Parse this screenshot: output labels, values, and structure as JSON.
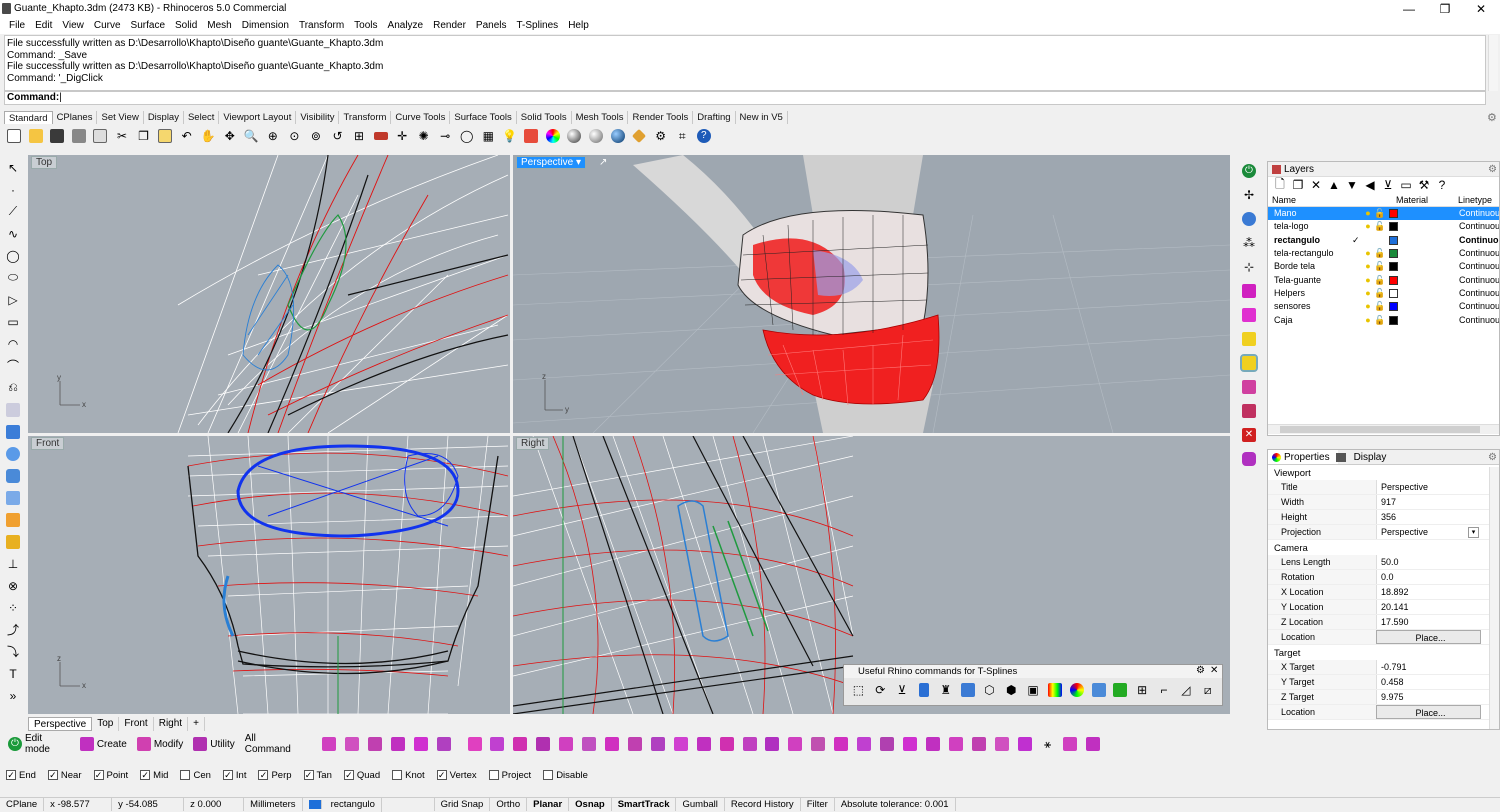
{
  "window": {
    "title": "Guante_Khapto.3dm (2473 KB) - Rhinoceros 5.0 Commercial",
    "minimize": "—",
    "maximize": "❐",
    "close": "✕"
  },
  "menu": [
    "File",
    "Edit",
    "View",
    "Curve",
    "Surface",
    "Solid",
    "Mesh",
    "Dimension",
    "Transform",
    "Tools",
    "Analyze",
    "Render",
    "Panels",
    "T-Splines",
    "Help"
  ],
  "history": [
    "File successfully written as D:\\Desarrollo\\Khapto\\Diseño guante\\Guante_Khapto.3dm",
    "Command: _Save",
    "File successfully written as D:\\Desarrollo\\Khapto\\Diseño guante\\Guante_Khapto.3dm",
    "Command: '_DigClick"
  ],
  "command_label": "Command:",
  "toolbar_tabs": [
    "Standard",
    "CPlanes",
    "Set View",
    "Display",
    "Select",
    "Viewport Layout",
    "Visibility",
    "Transform",
    "Curve Tools",
    "Surface Tools",
    "Solid Tools",
    "Mesh Tools",
    "Render Tools",
    "Drafting",
    "New in V5"
  ],
  "standard_icons": [
    "new-icon",
    "open-icon",
    "save-icon",
    "print-icon",
    "import-icon",
    "cut-icon",
    "copy-icon",
    "paste-icon",
    "undo-icon",
    "pan-icon",
    "rotate-icon",
    "zoom-dynamic-icon",
    "zoom-window-icon",
    "zoom-extents-icon",
    "zoom-selected-icon",
    "undo-view-icon",
    "four-viewports-icon",
    "cplane-icon",
    "point-icon",
    "lights-icon",
    "distance-icon",
    "circle-icon",
    "grid-icon",
    "lightbulb-icon",
    "shade-icon",
    "render-color-icon",
    "rendered-icon",
    "ghosted-icon",
    "render-icon",
    "material-icon",
    "gear-icon",
    "options-icon",
    "help-icon"
  ],
  "viewports": {
    "top": "Top",
    "perspective": "Perspective",
    "front": "Front",
    "right": "Right"
  },
  "viewport_tabs": [
    "Perspective",
    "Top",
    "Front",
    "Right",
    "+"
  ],
  "floating_panel": {
    "title": "Useful Rhino commands for T-Splines"
  },
  "layers": {
    "title": "Layers",
    "columns": {
      "name": "Name",
      "material": "Material",
      "linetype": "Linetype"
    },
    "rows": [
      {
        "name": "Mano",
        "color": "#ff0000",
        "current": false,
        "selected": true,
        "linetype": "Continuous"
      },
      {
        "name": "tela-logo",
        "color": "#000000",
        "current": false,
        "selected": false,
        "linetype": "Continuous"
      },
      {
        "name": "rectangulo",
        "color": "#1e6fd9",
        "current": true,
        "selected": false,
        "linetype": "Continuous"
      },
      {
        "name": "tela-rectangulo",
        "color": "#1a8a3a",
        "current": false,
        "selected": false,
        "linetype": "Continuous"
      },
      {
        "name": "Borde tela",
        "color": "#000000",
        "current": false,
        "selected": false,
        "linetype": "Continuous"
      },
      {
        "name": "Tela-guante",
        "color": "#ff0000",
        "current": false,
        "selected": false,
        "linetype": "Continuous"
      },
      {
        "name": "Helpers",
        "color": "#ffffff",
        "current": false,
        "selected": false,
        "linetype": "Continuous"
      },
      {
        "name": "sensores",
        "color": "#0000ff",
        "current": false,
        "selected": false,
        "linetype": "Continuous"
      },
      {
        "name": "Caja",
        "color": "#000000",
        "current": false,
        "selected": false,
        "linetype": "Continuous"
      }
    ]
  },
  "properties": {
    "tab1": "Properties",
    "tab2": "Display",
    "viewport_section": "Viewport",
    "title_label": "Title",
    "title_value": "Perspective",
    "width_label": "Width",
    "width_value": "917",
    "height_label": "Height",
    "height_value": "356",
    "projection_label": "Projection",
    "projection_value": "Perspective",
    "camera_section": "Camera",
    "lens_label": "Lens Length",
    "lens_value": "50.0",
    "rotation_label": "Rotation",
    "rotation_value": "0.0",
    "xloc_label": "X Location",
    "xloc_value": "18.892",
    "yloc_label": "Y Location",
    "yloc_value": "20.141",
    "zloc_label": "Z Location",
    "zloc_value": "17.590",
    "location_label": "Location",
    "place_label": "Place...",
    "target_section": "Target",
    "xtarget_label": "X Target",
    "xtarget_value": "-0.791",
    "ytarget_label": "Y Target",
    "ytarget_value": "0.458",
    "ztarget_label": "Z Target",
    "ztarget_value": "9.975",
    "tlocation_label": "Location",
    "tplace_label": "Place..."
  },
  "tsplines": {
    "edit_mode": "Edit mode",
    "create": "Create",
    "modify": "Modify",
    "utility": "Utility",
    "all_command": "All Command"
  },
  "osnaps": [
    {
      "label": "End",
      "checked": true
    },
    {
      "label": "Near",
      "checked": true
    },
    {
      "label": "Point",
      "checked": true
    },
    {
      "label": "Mid",
      "checked": true
    },
    {
      "label": "Cen",
      "checked": false
    },
    {
      "label": "Int",
      "checked": true
    },
    {
      "label": "Perp",
      "checked": true
    },
    {
      "label": "Tan",
      "checked": true
    },
    {
      "label": "Quad",
      "checked": true
    },
    {
      "label": "Knot",
      "checked": false
    },
    {
      "label": "Vertex",
      "checked": true
    },
    {
      "label": "Project",
      "checked": false
    },
    {
      "label": "Disable",
      "checked": false
    }
  ],
  "status": {
    "cplane": "CPlane",
    "x": "x -98.577",
    "y": "y -54.085",
    "z": "z 0.000",
    "units": "Millimeters",
    "layer": "rectangulo",
    "grid_snap": "Grid Snap",
    "ortho": "Ortho",
    "planar": "Planar",
    "osnap": "Osnap",
    "smarttrack": "SmartTrack",
    "gumball": "Gumball",
    "record_history": "Record History",
    "filter": "Filter",
    "tolerance": "Absolute tolerance: 0.001"
  }
}
